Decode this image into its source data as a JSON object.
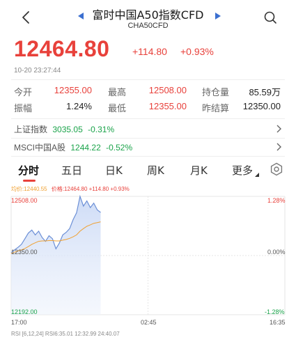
{
  "header": {
    "title": "富时中国A50指数CFD",
    "subtitle": "CHA50CFD"
  },
  "quote": {
    "price": "12464.80",
    "change": "+114.80",
    "change_pct": "+0.93%",
    "timestamp": "10-20 23:27:44"
  },
  "stats": {
    "open_label": "今开",
    "open_value": "12355.00",
    "high_label": "最高",
    "high_value": "12508.00",
    "oi_label": "持仓量",
    "oi_value": "85.59万",
    "amp_label": "振幅",
    "amp_value": "1.24%",
    "low_label": "最低",
    "low_value": "12355.00",
    "settle_label": "昨结算",
    "settle_value": "12350.00"
  },
  "indices": [
    {
      "name": "上证指数",
      "value": "3035.05",
      "pct": "-0.31%"
    },
    {
      "name": "MSCI中国A股",
      "value": "1244.22",
      "pct": "-0.52%"
    }
  ],
  "tabs": [
    "分时",
    "五日",
    "日K",
    "周K",
    "月K",
    "更多"
  ],
  "legend": {
    "avg": "均价:12440.55",
    "price": "价格:12464.80 +114.80 +0.93%"
  },
  "chart_axis": {
    "y_top": "12508.00",
    "y_mid": "12350.00",
    "y_bot": "12192.00",
    "pct_top": "1.28%",
    "pct_mid": "0.00%",
    "pct_bot": "-1.28%",
    "x_start": "17:00",
    "x_mid": "02:45",
    "x_end": "16:35"
  },
  "chart_data": {
    "type": "line",
    "ylim": [
      12192,
      12508
    ],
    "x_range": [
      "17:00",
      "16:35"
    ],
    "series": [
      {
        "values": [
          12358,
          12365,
          12372,
          12380,
          12395,
          12410,
          12418,
          12405,
          12415,
          12398,
          12388,
          12403,
          12395,
          12368,
          12383,
          12405,
          12412,
          12422,
          12446,
          12464,
          12508,
          12482,
          12496,
          12478,
          12490,
          12472,
          12465
        ]
      },
      {
        "values": [
          12356,
          12359,
          12362,
          12365,
          12369,
          12374,
          12380,
          12384,
          12388,
          12389,
          12389,
          12390,
          12390,
          12389,
          12389,
          12391,
          12393,
          12396,
          12400,
          12405,
          12415,
          12422,
          12428,
          12432,
          12436,
          12438,
          12440
        ]
      }
    ]
  },
  "bottom_tags": "RSI [6,12,24]  RSI6:35.01  12:32.99  24:40.07",
  "colors": {
    "up": "#e8413b",
    "down": "#1aa34a",
    "avg": "#f0a030",
    "line": "#6b8fd6"
  }
}
